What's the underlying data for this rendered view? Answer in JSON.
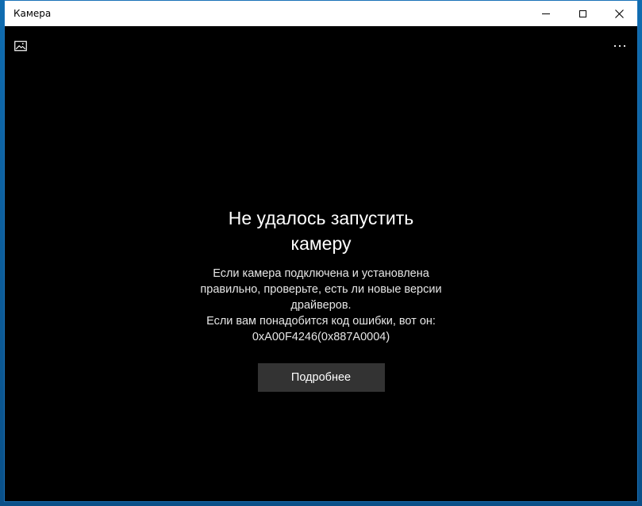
{
  "window": {
    "title": "Камера"
  },
  "caption_buttons": {
    "minimize_icon": "minimize-icon",
    "maximize_icon": "maximize-icon",
    "close_icon": "close-icon"
  },
  "toolbar": {
    "gallery_icon": "image-gallery-icon",
    "more_icon": "more-options-icon"
  },
  "error": {
    "title": "Не удалось запустить камеру",
    "message_line1": "Если камера подключена и установлена правильно, проверьте, есть ли новые версии драйверов.",
    "message_line2": "Если вам понадобится код ошибки, вот он: 0xA00F4246(0x887A0004)",
    "details_label": "Подробнее"
  },
  "colors": {
    "background": "#000000",
    "button": "#333333",
    "titlebar": "#ffffff",
    "accent_border": "#1a72b8"
  }
}
